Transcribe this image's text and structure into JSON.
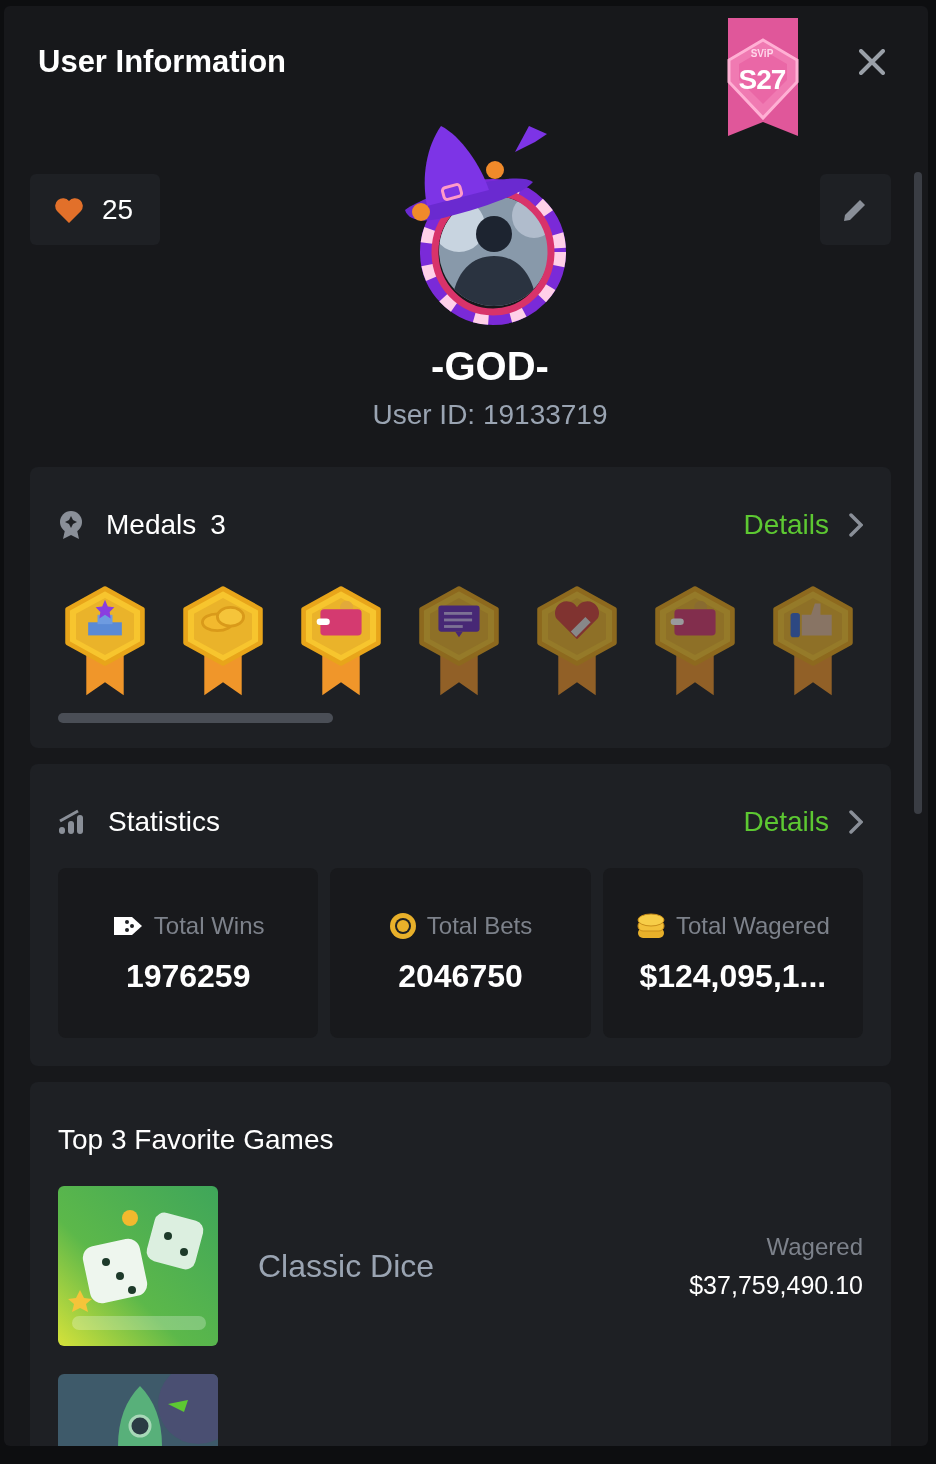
{
  "header": {
    "title": "User Information",
    "vip_badge": {
      "tier": "SViP",
      "level": "S27"
    }
  },
  "likes": "25",
  "user": {
    "name": "-GOD-",
    "user_id": "User ID: 19133719"
  },
  "medals": {
    "title": "Medals",
    "count": "3",
    "details": "Details",
    "items": [
      {
        "kind": "podium",
        "earned": true
      },
      {
        "kind": "coins",
        "earned": true
      },
      {
        "kind": "wallet",
        "earned": true
      },
      {
        "kind": "chat",
        "earned": false
      },
      {
        "kind": "heart",
        "earned": false
      },
      {
        "kind": "wallet",
        "earned": false
      },
      {
        "kind": "thumb",
        "earned": false
      }
    ]
  },
  "statistics": {
    "title": "Statistics",
    "details": "Details",
    "items": [
      {
        "kind": "wins",
        "label": "Total Wins",
        "value": "1976259"
      },
      {
        "kind": "bets",
        "label": "Total Bets",
        "value": "2046750"
      },
      {
        "kind": "wagered",
        "label": "Total Wagered",
        "value": "$124,095,1..."
      }
    ]
  },
  "favorite_games": {
    "title": "Top 3 Favorite Games",
    "games": [
      {
        "kind": "dice",
        "name": "Classic Dice",
        "wagered_label": "Wagered",
        "wagered": "$37,759,490.10"
      },
      {
        "kind": "rocket"
      }
    ]
  }
}
